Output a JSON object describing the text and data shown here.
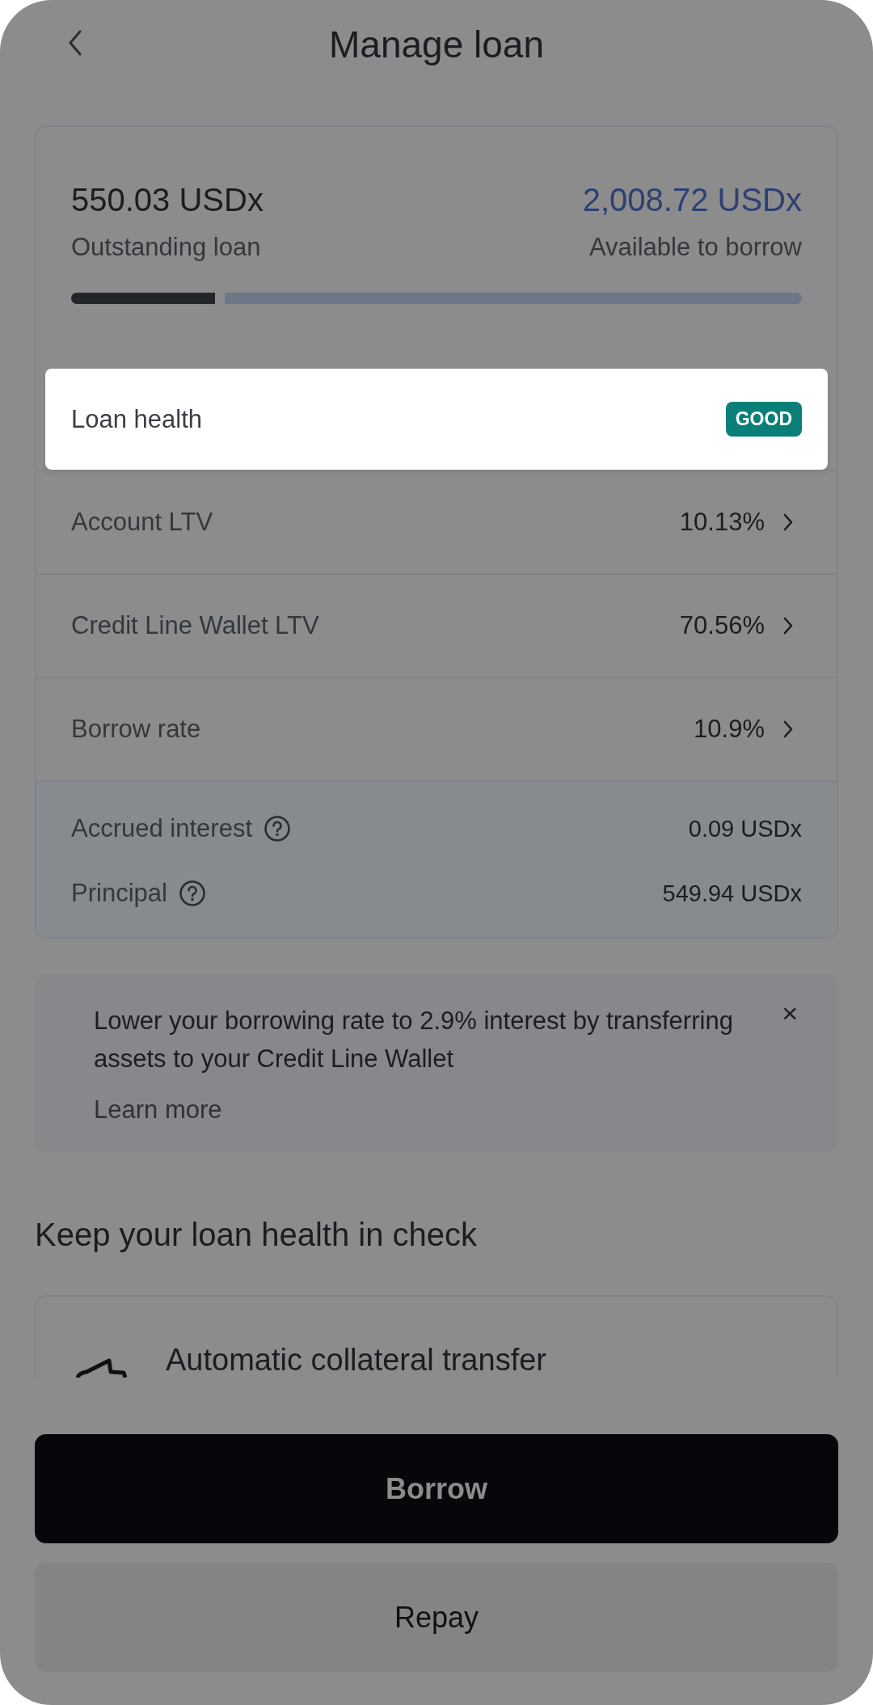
{
  "header": {
    "title": "Manage loan"
  },
  "summary": {
    "outstanding_amount": "550.03 USDx",
    "outstanding_label": "Outstanding loan",
    "available_amount": "2,008.72 USDx",
    "available_label": "Available to borrow",
    "level": 0.21
  },
  "loan_health": {
    "label": "Loan health",
    "badge": "GOOD"
  },
  "rows": [
    {
      "label": "Account LTV",
      "value": "10.13%"
    },
    {
      "label": "Credit Line Wallet LTV",
      "value": "70.56%"
    },
    {
      "label": "Borrow rate",
      "value": "10.9%"
    }
  ],
  "details": [
    {
      "label": "Accrued interest",
      "value": "0.09 USDx"
    },
    {
      "label": "Principal",
      "value": "549.94 USDx"
    }
  ],
  "banner": {
    "text": "Lower your borrowing rate to 2.9% interest by transferring assets to your Credit Line Wallet",
    "link": "Learn more",
    "close": "×"
  },
  "section": {
    "title": "Keep your loan health in check",
    "items": [
      {
        "title": "Automatic collateral transfer"
      }
    ]
  },
  "buttons": [
    {
      "label": "Borrow",
      "kind": "primary"
    },
    {
      "label": "Repay",
      "kind": "secondary"
    }
  ]
}
